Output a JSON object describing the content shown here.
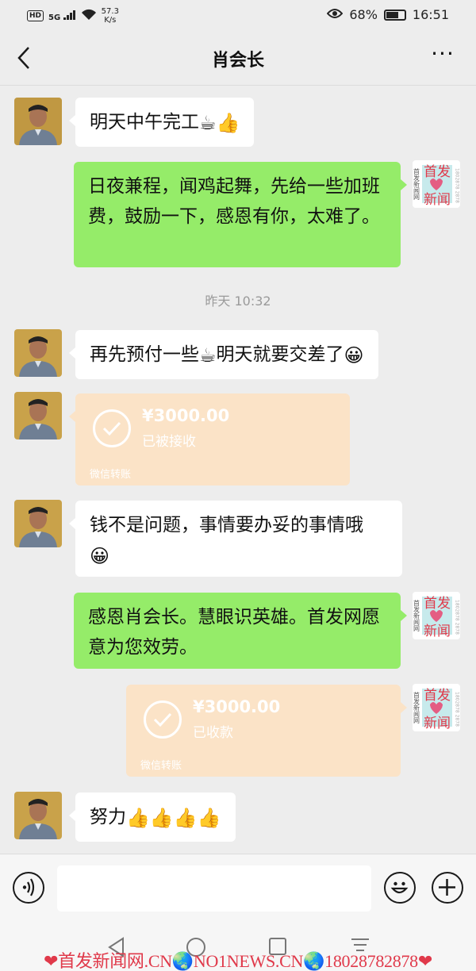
{
  "status_bar": {
    "hd_badge": "HD",
    "network": "5G",
    "net_speed_value": "57.3",
    "net_speed_unit": "K/s",
    "battery_percent": "68%",
    "battery_level": 0.68,
    "time": "16:51"
  },
  "header": {
    "title": "肖会长",
    "more_label": "···"
  },
  "messages": [
    {
      "from": "contact",
      "type": "text",
      "text": "明天中午完工",
      "emojis": [
        "coffee",
        "thumbs-up"
      ]
    },
    {
      "from": "me",
      "type": "text",
      "text": "日夜兼程，闻鸡起舞，先给一些加班费，鼓励一下，感恩有你，太难了。"
    },
    {
      "type": "time",
      "text": "昨天 10:32"
    },
    {
      "from": "contact",
      "type": "text",
      "text_before": "再先预付一些",
      "text_after": "明天就要交差了",
      "emojis": [
        "coffee",
        "smile"
      ]
    },
    {
      "from": "contact",
      "type": "transfer",
      "amount": "¥3000.00",
      "status": "已被接收",
      "source": "微信转账"
    },
    {
      "from": "contact",
      "type": "text",
      "text": "钱不是问题，事情要办妥的事情哦",
      "emojis": [
        "smile"
      ]
    },
    {
      "from": "me",
      "type": "text",
      "text": "感恩肖会长。慧眼识英雄。首发网愿意为您效劳。"
    },
    {
      "from": "me",
      "type": "transfer",
      "amount": "¥3000.00",
      "status": "已收款",
      "source": "微信转账"
    },
    {
      "from": "contact",
      "type": "text",
      "text": "努力",
      "emojis": [
        "thumbs-up",
        "thumbs-up",
        "thumbs-up",
        "thumbs-up"
      ]
    }
  ],
  "my_avatar": {
    "main_top": "首发",
    "main_bottom": "新闻",
    "side_left": "首发新闻网",
    "side_right": "1802878 2878"
  },
  "input_bar": {
    "voice_icon": "voice-icon",
    "emoji_icon": "emoji-face-icon",
    "plus_icon": "plus-icon"
  },
  "watermark": "❤首发新闻网.CN🌏NO1NEWS.CN🌏18028782878❤",
  "colors": {
    "background": "#ededed",
    "green_bubble": "#95ec69",
    "white_bubble": "#ffffff",
    "transfer_card": "#fbe3c7",
    "watermark": "#e0394a"
  }
}
